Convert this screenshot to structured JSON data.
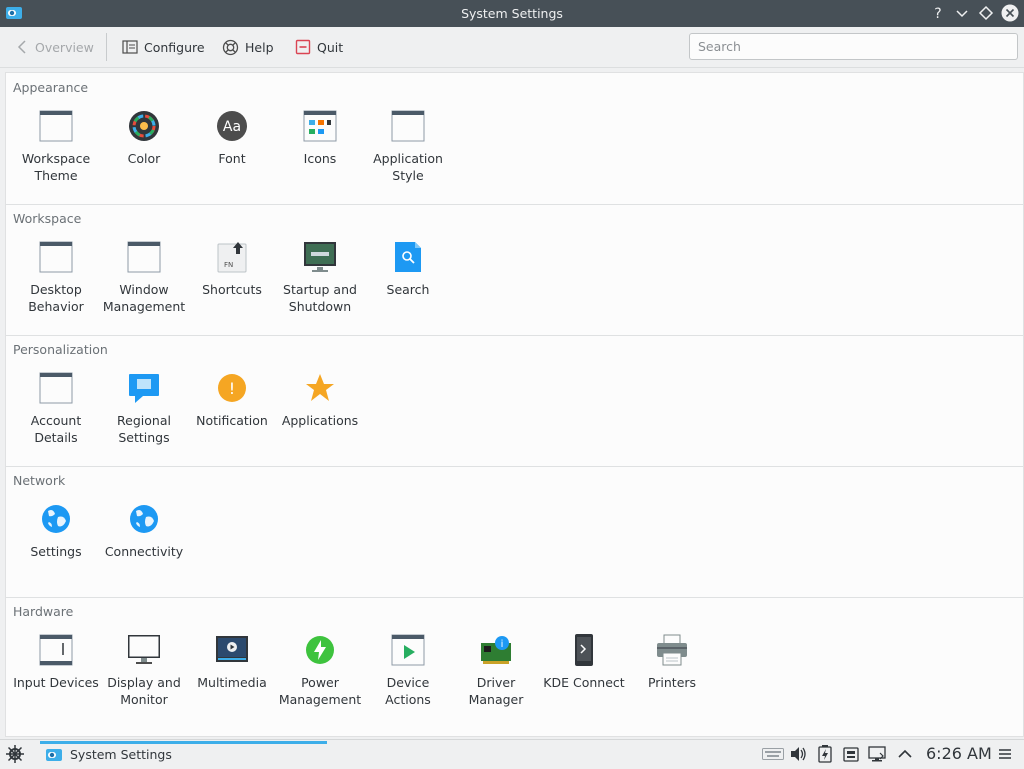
{
  "window": {
    "title": "System Settings"
  },
  "toolbar": {
    "overview": "Overview",
    "configure": "Configure",
    "help": "Help",
    "quit": "Quit",
    "search_placeholder": "Search"
  },
  "sections": [
    {
      "title": "Appearance",
      "items": [
        {
          "label": "Workspace Theme",
          "icon": "workspace-theme-icon"
        },
        {
          "label": "Color",
          "icon": "color-icon"
        },
        {
          "label": "Font",
          "icon": "font-icon"
        },
        {
          "label": "Icons",
          "icon": "icons-icon"
        },
        {
          "label": "Application Style",
          "icon": "application-style-icon"
        }
      ]
    },
    {
      "title": "Workspace",
      "items": [
        {
          "label": "Desktop Behavior",
          "icon": "desktop-behavior-icon"
        },
        {
          "label": "Window Management",
          "icon": "window-management-icon"
        },
        {
          "label": "Shortcuts",
          "icon": "shortcuts-icon"
        },
        {
          "label": "Startup and Shutdown",
          "icon": "startup-shutdown-icon"
        },
        {
          "label": "Search",
          "icon": "search-icon"
        }
      ]
    },
    {
      "title": "Personalization",
      "items": [
        {
          "label": "Account Details",
          "icon": "account-details-icon"
        },
        {
          "label": "Regional Settings",
          "icon": "regional-settings-icon"
        },
        {
          "label": "Notification",
          "icon": "notification-icon"
        },
        {
          "label": "Applications",
          "icon": "applications-star-icon"
        }
      ]
    },
    {
      "title": "Network",
      "items": [
        {
          "label": "Settings",
          "icon": "globe-icon"
        },
        {
          "label": "Connectivity",
          "icon": "globe-icon"
        }
      ]
    },
    {
      "title": "Hardware",
      "items": [
        {
          "label": "Input Devices",
          "icon": "input-devices-icon"
        },
        {
          "label": "Display and Monitor",
          "icon": "display-monitor-icon"
        },
        {
          "label": "Multimedia",
          "icon": "multimedia-icon"
        },
        {
          "label": "Power Management",
          "icon": "power-icon"
        },
        {
          "label": "Device Actions",
          "icon": "device-actions-icon"
        },
        {
          "label": "Driver Manager",
          "icon": "driver-manager-icon"
        },
        {
          "label": "KDE Connect",
          "icon": "kde-connect-icon"
        },
        {
          "label": "Printers",
          "icon": "printer-icon"
        }
      ]
    }
  ],
  "taskbar": {
    "task_label": "System Settings",
    "clock": "6:26 AM"
  },
  "colors": {
    "accent": "#3daee9",
    "titlebar": "#475057",
    "background": "#eff0f1"
  }
}
